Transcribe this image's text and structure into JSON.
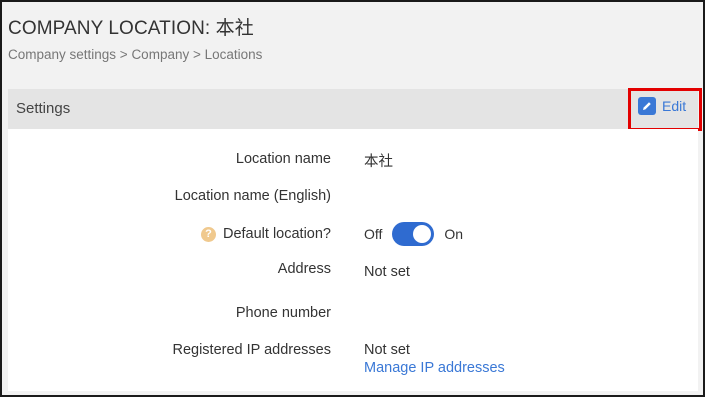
{
  "page": {
    "title": "COMPANY LOCATION: 本社",
    "breadcrumb": "Company settings > Company > Locations"
  },
  "card": {
    "header_title": "Settings",
    "edit_label": "Edit"
  },
  "fields": {
    "location_name_label": "Location name",
    "location_name_value": "本社",
    "location_name_en_label": "Location name (English)",
    "default_location_label": "Default location?",
    "default_location_off": "Off",
    "default_location_on": "On",
    "default_location_state": "on",
    "address_label": "Address",
    "address_value": "Not set",
    "phone_label": "Phone number",
    "ip_label": "Registered IP addresses",
    "ip_value": "Not set",
    "ip_link": "Manage IP addresses"
  },
  "colors": {
    "accent": "#3a78d6",
    "toggle_on": "#2f6bd0",
    "highlight_box": "#e30000",
    "help_icon": "#f0c98e"
  },
  "icons": {
    "edit": "pencil-icon",
    "help": "question-circle-icon"
  }
}
